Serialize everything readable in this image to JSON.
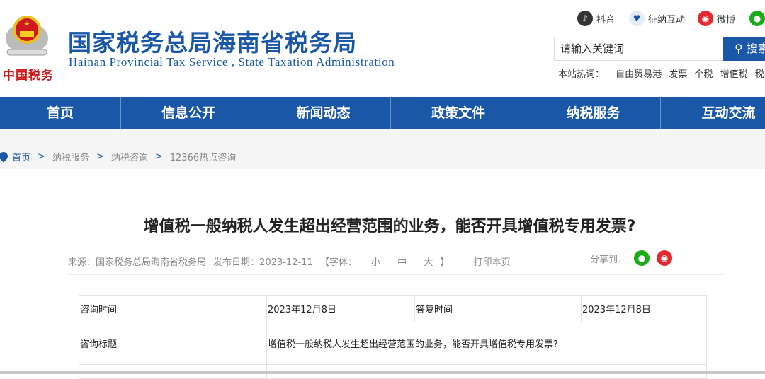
{
  "header": {
    "logo_text": "中国税务",
    "title": "国家税务总局海南省税务局",
    "subtitle": "Hainan  Provincial  Tax Service , State Taxation Administration",
    "social": [
      {
        "label": "抖音",
        "color": "#333333"
      },
      {
        "label": "征纳互动",
        "color": "#e3ecf7"
      },
      {
        "label": "微博",
        "color": "#e6282e"
      },
      {
        "label": "",
        "color": "#1aad19"
      }
    ],
    "search_placeholder": "请输入关键词",
    "search_button": "搜索",
    "hot_label": "本站热词：",
    "hot_words": [
      "自由贸易港",
      "发票",
      "个税",
      "增值税",
      "税收优惠"
    ]
  },
  "nav": [
    "首页",
    "信息公开",
    "新闻动态",
    "政策文件",
    "纳税服务",
    "互动交流"
  ],
  "breadcrumb": [
    "首页",
    "纳税服务",
    "纳税咨询",
    "12366热点咨询"
  ],
  "article": {
    "title": "增值税一般纳税人发生超出经营范围的业务，能否开具增值税专用发票?",
    "source": "来源：国家税务总局海南省税务局",
    "date": "发布日期：2023-12-11",
    "font_label": "【字体：",
    "font_small": "小",
    "font_mid": "中",
    "font_large": "大",
    "font_close": "】",
    "print": "打印本页",
    "share": "分享到："
  },
  "table": {
    "ask_time_label": "咨询时间",
    "ask_time": "2023年12月8日",
    "reply_time_label": "答复时间",
    "reply_time": "2023年12月8日",
    "title_label": "咨询标题",
    "title_value": "增值税一般纳税人发生超出经营范围的业务，能否开具增值税专用发票?"
  }
}
